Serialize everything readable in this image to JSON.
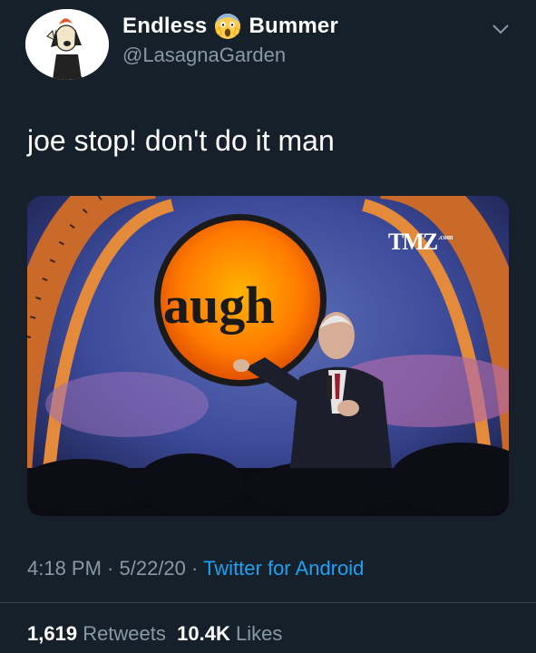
{
  "user": {
    "name_first": "Endless",
    "name_emoji": "face-screaming-in-fear-emoji",
    "name_last": "Bummer",
    "handle": "@LasagnaGarden"
  },
  "tweet": {
    "text": "joe stop! don't do it man"
  },
  "media": {
    "sign_text": "augh",
    "watermark": "TMZ",
    "watermark_sub": ".com"
  },
  "meta": {
    "time": "4:18 PM",
    "sep1": " · ",
    "date": "5/22/20",
    "sep2": " · ",
    "source": "Twitter for Android"
  },
  "stats": {
    "retweets_count": "1,619",
    "retweets_label": "Retweets",
    "likes_count": "10.4K",
    "likes_label": "Likes"
  },
  "colors": {
    "background": "#15202b",
    "secondary_text": "#8899a6",
    "link": "#1da1f2",
    "divider": "#38444d"
  }
}
